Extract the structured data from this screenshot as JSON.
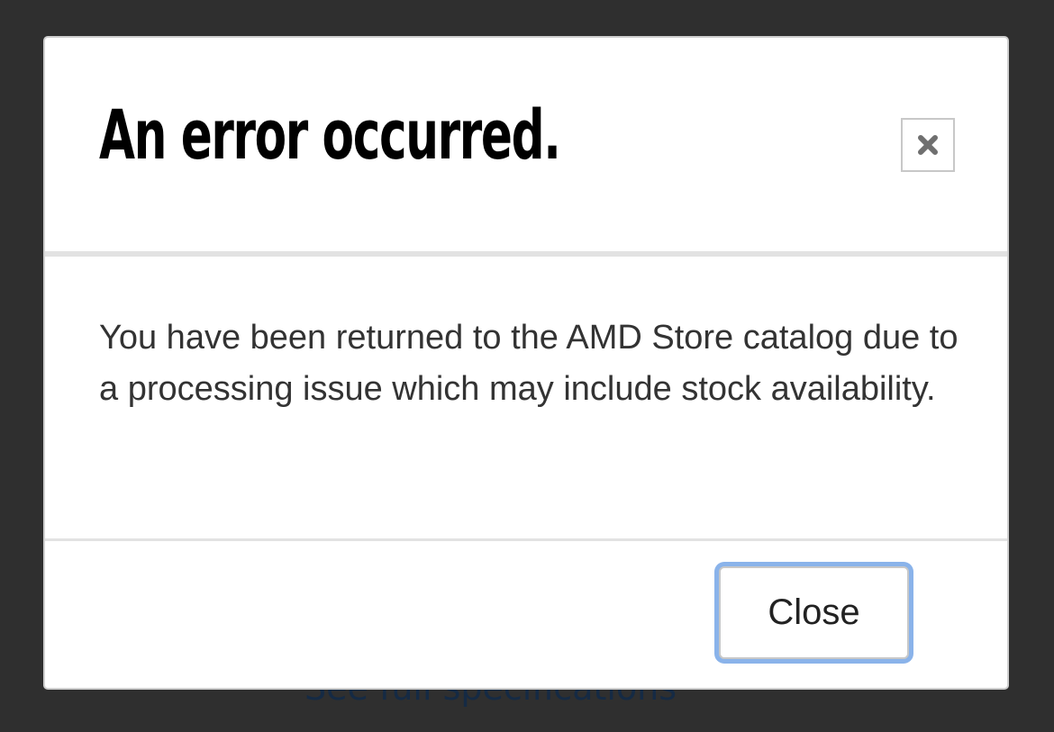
{
  "background": {
    "partial_link_text": "See full specifications"
  },
  "dialog": {
    "title": "An error occurred.",
    "close_icon": "close-x-icon",
    "message": "You have been returned to the AMD Store catalog due to a processing issue which may include stock availability.",
    "close_button_label": "Close"
  },
  "colors": {
    "backdrop": "#2f2f2f",
    "dialog_background": "#ffffff",
    "title_text": "#000000",
    "body_text": "#333333",
    "focus_ring": "#8ab3ea",
    "divider": "#e2e2e2"
  }
}
